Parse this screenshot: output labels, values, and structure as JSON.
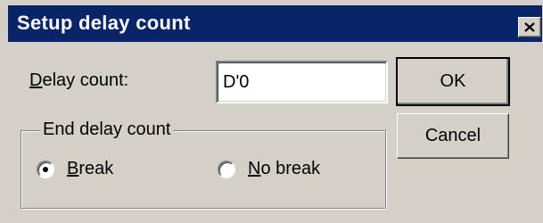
{
  "window": {
    "title": "Setup delay count",
    "close_icon": "close-icon"
  },
  "delay": {
    "label_accel": "D",
    "label_rest": "elay count:",
    "value": "D'0"
  },
  "buttons": {
    "ok": "OK",
    "cancel": "Cancel"
  },
  "end_group": {
    "legend": "End delay count",
    "options": [
      {
        "accel": "B",
        "rest": "reak",
        "selected": true
      },
      {
        "accel": "N",
        "rest": "o break",
        "selected": false
      }
    ]
  }
}
